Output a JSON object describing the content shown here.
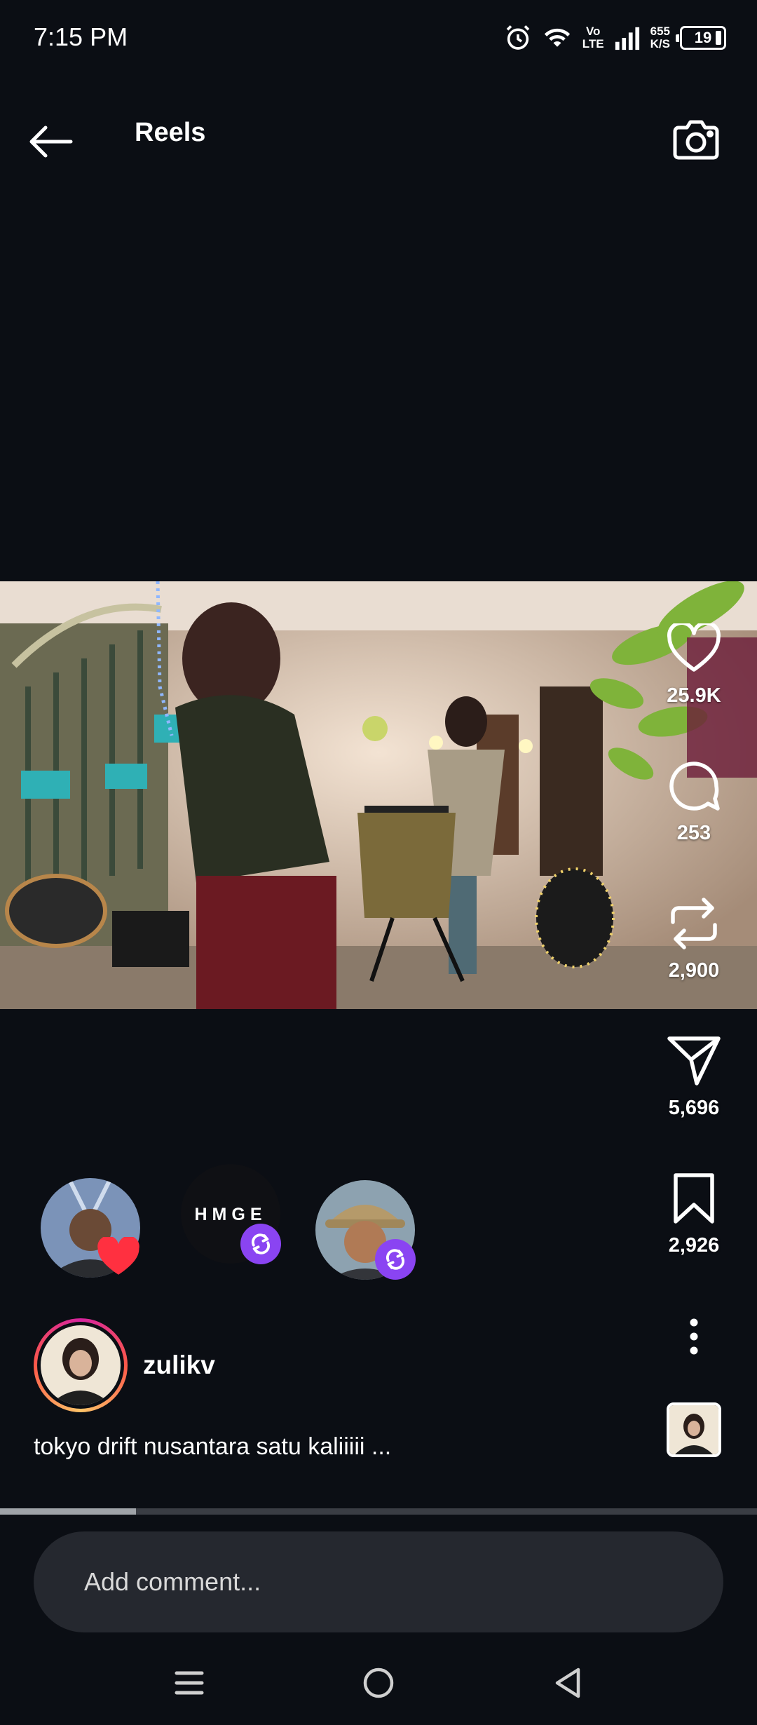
{
  "status_bar": {
    "time": "7:15 PM",
    "volte_top": "Vo",
    "volte_bottom": "LTE",
    "net_speed_value": "655",
    "net_speed_unit": "K/S",
    "battery": "19",
    "icons": [
      "alarm-icon",
      "wifi-icon",
      "signal-icon",
      "battery-icon"
    ]
  },
  "header": {
    "title": "Reels",
    "back_icon": "arrow-left-icon",
    "camera_icon": "camera-icon"
  },
  "actions": {
    "likes": "25.9K",
    "comments": "253",
    "reposts": "2,900",
    "shares": "5,696",
    "saves": "2,926"
  },
  "friends_activity": [
    {
      "kind": "like",
      "badge_icon": "heart-icon"
    },
    {
      "kind": "repost",
      "label": "HMGE",
      "badge_icon": "repost-icon"
    },
    {
      "kind": "repost",
      "badge_icon": "repost-icon"
    }
  ],
  "author": {
    "username": "zulikv",
    "caption": "tokyo drift nusantara satu kaliiiii ..."
  },
  "playback": {
    "progress": 0.18
  },
  "comment": {
    "placeholder": "Add comment..."
  },
  "colors": {
    "background": "#0b0e14",
    "accent_repost": "#8a44f2",
    "heart": "#ff3040"
  }
}
